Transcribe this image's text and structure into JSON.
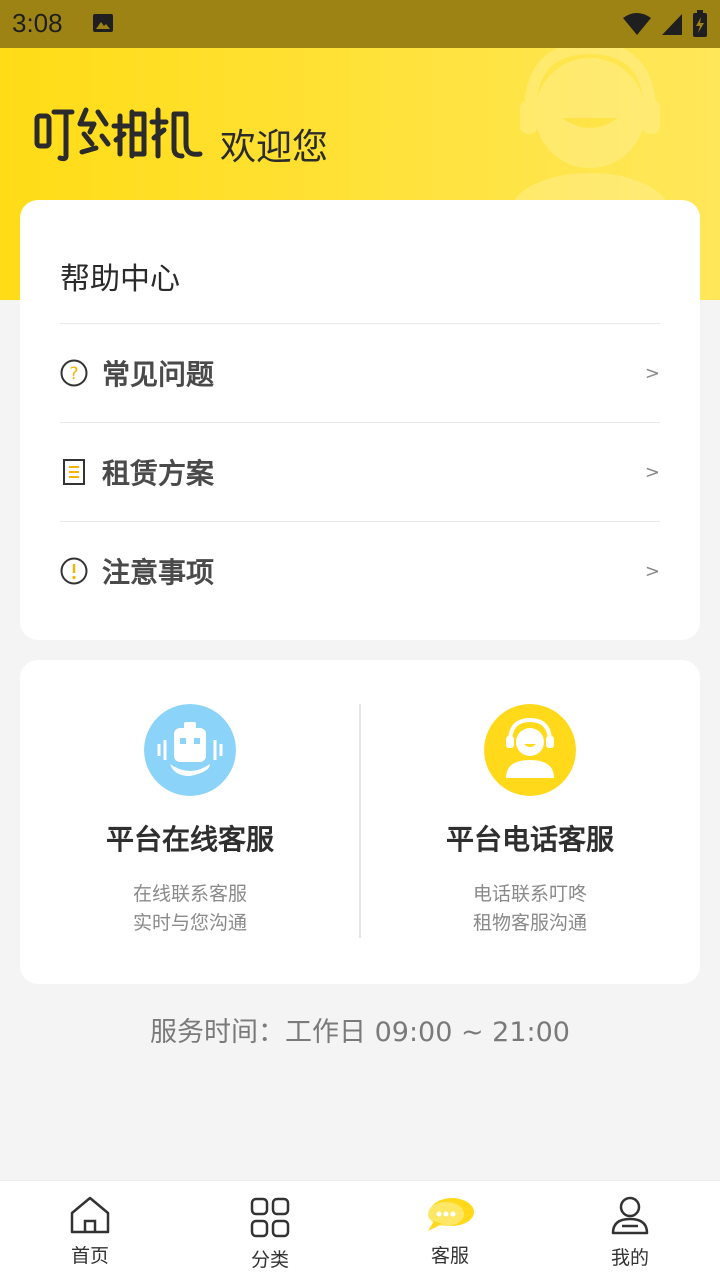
{
  "status_bar": {
    "time": "3:08"
  },
  "hero": {
    "brand": "叮咚租机",
    "welcome": "欢迎您"
  },
  "help_center": {
    "title": "帮助中心",
    "items": [
      {
        "label": "常见问题",
        "icon": "question-circle-icon",
        "chevron": ">"
      },
      {
        "label": "租赁方案",
        "icon": "document-list-icon",
        "chevron": ">"
      },
      {
        "label": "注意事项",
        "icon": "exclamation-circle-icon",
        "chevron": ">"
      }
    ]
  },
  "services": {
    "online": {
      "title": "平台在线客服",
      "desc_line1": "在线联系客服",
      "desc_line2": "实时与您沟通",
      "icon": "robot-icon",
      "color": "#8bd3f8"
    },
    "phone": {
      "title": "平台电话客服",
      "desc_line1": "电话联系叮咚",
      "desc_line2": "租物客服沟通",
      "icon": "headset-agent-icon",
      "color": "#ffd91a"
    }
  },
  "service_time": "服务时间：工作日 09:00 ~ 21:00",
  "tabbar": {
    "items": [
      {
        "label": "首页",
        "icon": "home-icon",
        "active": false
      },
      {
        "label": "分类",
        "icon": "grid-icon",
        "active": false
      },
      {
        "label": "客服",
        "icon": "chat-bubble-icon",
        "active": true
      },
      {
        "label": "我的",
        "icon": "user-icon",
        "active": false
      }
    ]
  },
  "colors": {
    "accent": "#ffdc16",
    "background": "#f4f4f4"
  }
}
